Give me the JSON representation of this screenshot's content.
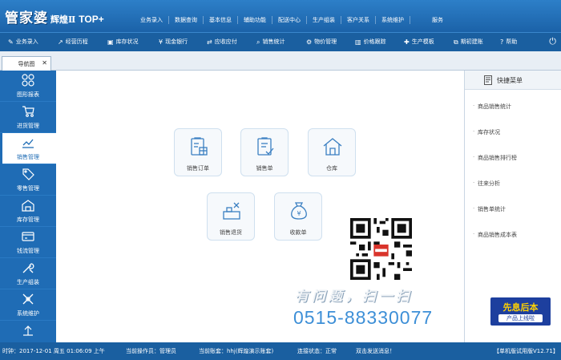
{
  "app": {
    "logo_text": "管家婆",
    "logo_edition": "辉煌Ⅱ",
    "logo_suffix": "TOP+"
  },
  "top_menu": [
    "业务录入",
    "数据查询",
    "基本信息",
    "辅助功能",
    "配送中心",
    "生产组装",
    "客户关系",
    "系统维护",
    "服务"
  ],
  "toolbar": [
    {
      "label": "业务录入",
      "icon": "wrench-icon"
    },
    {
      "label": "经营历程",
      "icon": "trend-icon"
    },
    {
      "label": "库存状况",
      "icon": "box-icon"
    },
    {
      "label": "现金银行",
      "icon": "yen-icon"
    },
    {
      "label": "应收应付",
      "icon": "cycle-icon"
    },
    {
      "label": "销售统计",
      "icon": "search-icon"
    },
    {
      "label": "物价管理",
      "icon": "gear-icon"
    },
    {
      "label": "价格跟踪",
      "icon": "chart-icon"
    },
    {
      "label": "生产模板",
      "icon": "puzzle-icon"
    },
    {
      "label": "期初建账",
      "icon": "external-icon"
    },
    {
      "label": "帮助",
      "icon": "help-icon"
    }
  ],
  "tab": {
    "label": "导航图",
    "close": "✕"
  },
  "sidebar": {
    "items": [
      {
        "label": "图形报表",
        "icon": "grid-icon"
      },
      {
        "label": "进货管理",
        "icon": "cart-icon"
      },
      {
        "label": "销售管理",
        "icon": "trend-icon",
        "active": true
      },
      {
        "label": "零售管理",
        "icon": "tag-icon"
      },
      {
        "label": "库存管理",
        "icon": "warehouse-icon"
      },
      {
        "label": "钱流管理",
        "icon": "card-icon"
      },
      {
        "label": "生产组装",
        "icon": "tools-icon"
      },
      {
        "label": "系统维护",
        "icon": "settings-icon"
      },
      {
        "label": "",
        "icon": "upload-icon"
      }
    ]
  },
  "nav_cards": [
    {
      "label": "销售订单",
      "icon": "order-icon"
    },
    {
      "label": "销售单",
      "icon": "clipboard-check-icon"
    },
    {
      "label": "仓库",
      "icon": "house-icon"
    },
    {
      "label": "销售退货",
      "icon": "return-icon"
    },
    {
      "label": "收款单",
      "icon": "money-bag-icon"
    }
  ],
  "promo": {
    "slogan": "有问题，扫一扫",
    "phone": "0515-88330077"
  },
  "right_panel": {
    "title": "快捷菜单",
    "items": [
      "商品销售统计",
      "库存状况",
      "商品销售排行榜",
      "往来分析",
      "销售单统计",
      "商品销售成本表"
    ],
    "badge_line1": "先息后本",
    "badge_line2": "产品上线啦"
  },
  "status": {
    "time": "时钟：2017-12-01 周五 01:06:09 上午",
    "operator": "当前操作员：管理员",
    "account": "当前账套：hhj(辉煌演示账套)",
    "connection": "连接状态：正常",
    "message": "双击发送消息！",
    "version": "【单机版试用版V12.71】"
  },
  "colors": {
    "primary": "#1f6cb5",
    "titlebar": "#2d7fc8",
    "statusbar": "#1a5fa0",
    "badge": "#1d3f9e",
    "badge_text": "#ffd200",
    "phone": "#3d8fd7"
  }
}
